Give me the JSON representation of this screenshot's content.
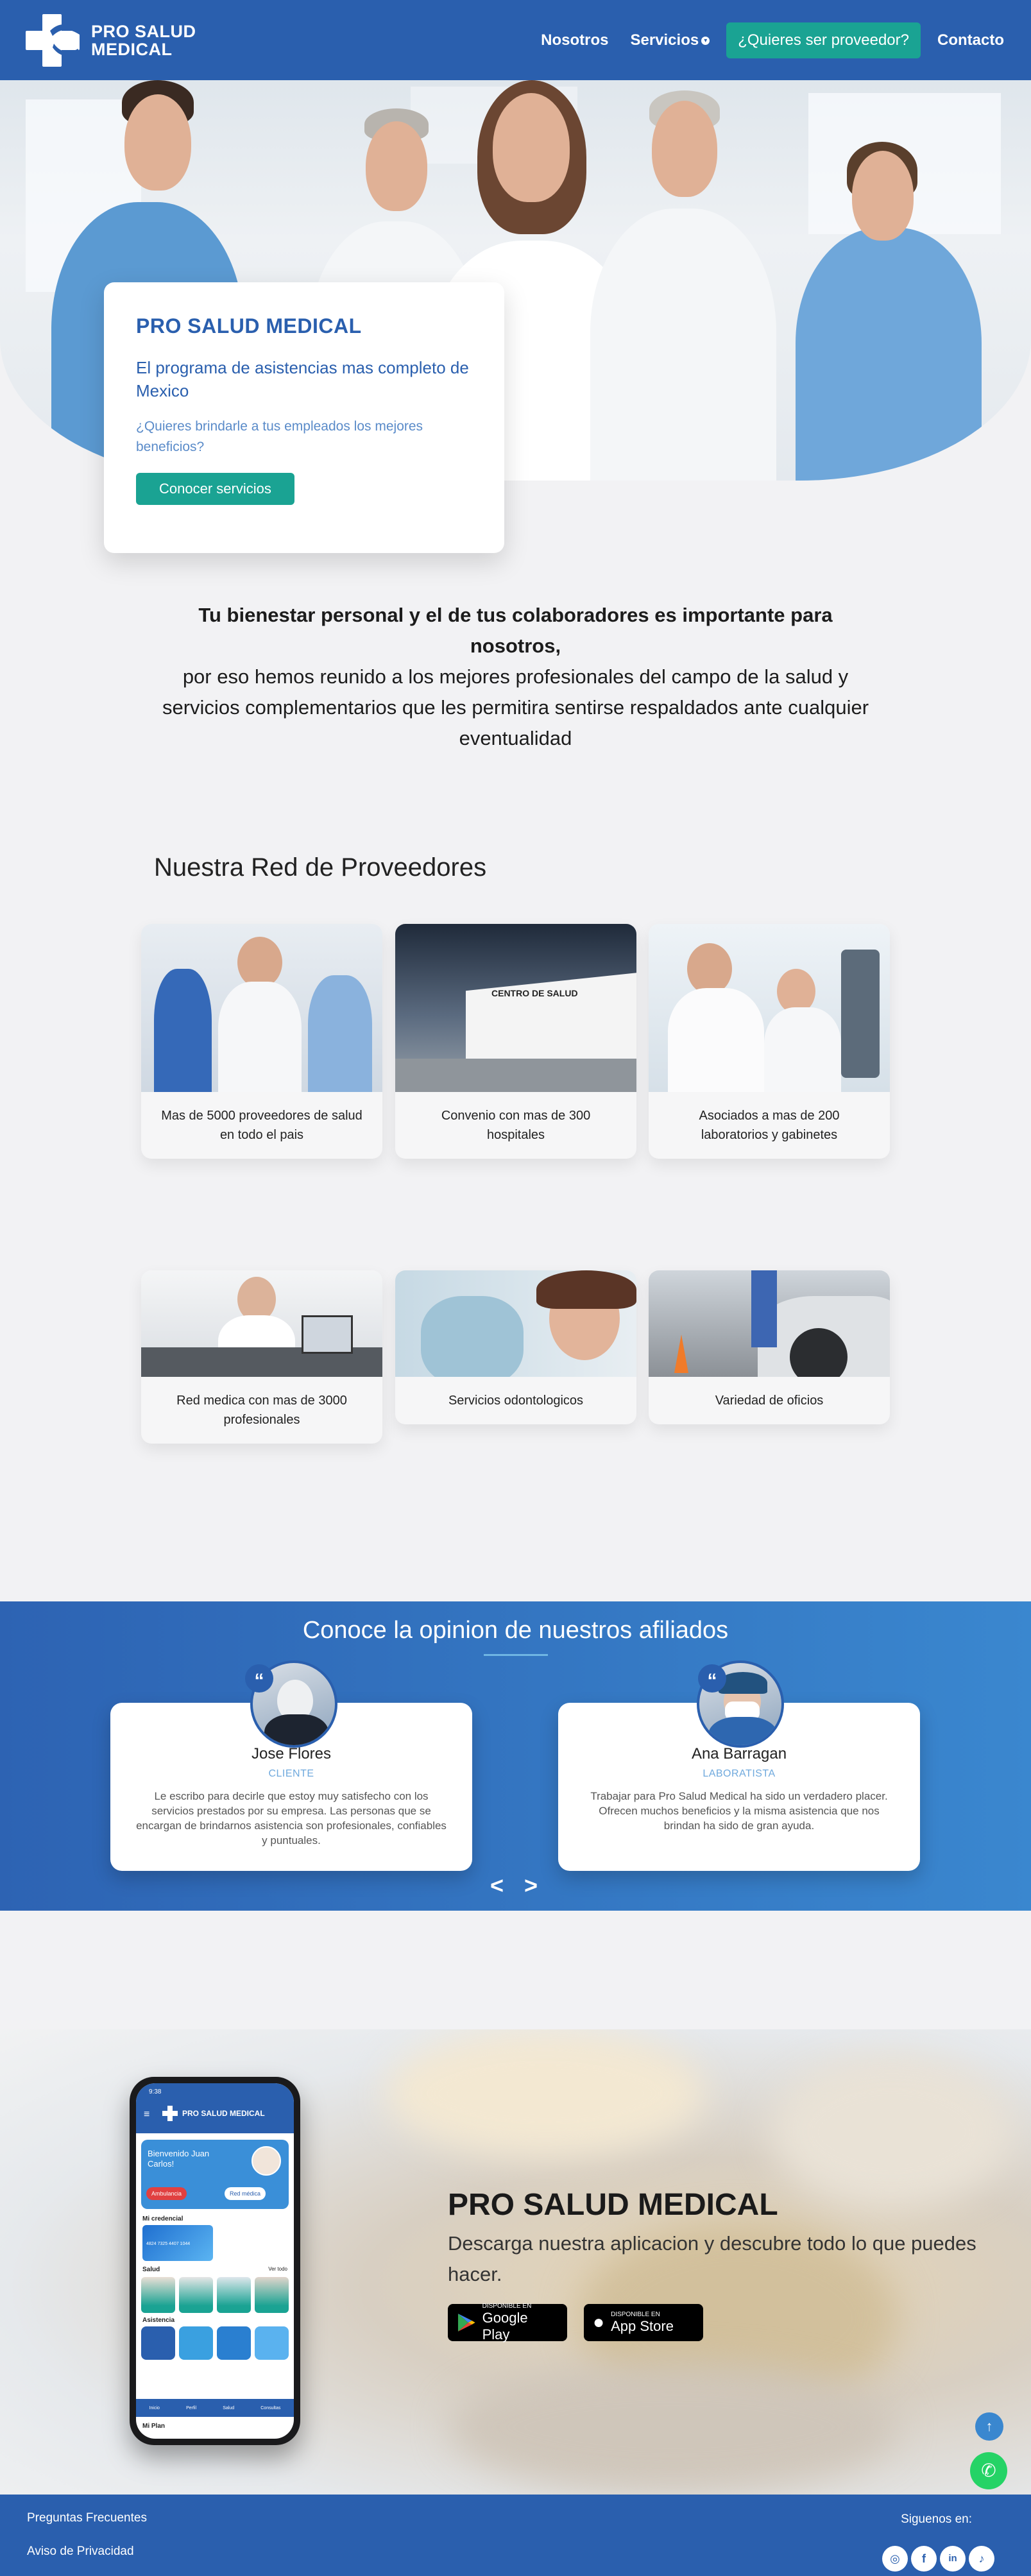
{
  "brand": {
    "line1": "PRO SALUD",
    "line2": "MEDICAL"
  },
  "nav": {
    "items": [
      {
        "label": "Nosotros"
      },
      {
        "label": "Servicios"
      },
      {
        "label": "¿Quieres ser proveedor?"
      },
      {
        "label": "Contacto"
      }
    ]
  },
  "hero": {
    "title": "PRO SALUD MEDICAL",
    "subtitle": "El programa de asistencias mas completo de Mexico",
    "question": "¿Quieres brindarle a tus empleados los mejores beneficios?",
    "button": "Conocer servicios"
  },
  "intro": {
    "bold": "Tu bienestar personal y el de tus colaboradores es importante para nosotros,",
    "rest": "por eso hemos reunido a los mejores profesionales del campo de la salud y servicios complementarios que les permitira sentirse respaldados ante cualquier eventualidad"
  },
  "providers": {
    "title": "Nuestra Red de Proveedores",
    "cards": [
      {
        "caption": "Mas de 5000 proveedores de salud en todo el pais"
      },
      {
        "caption": "Convenio con mas de 300 hospitales"
      },
      {
        "caption": "Asociados a mas de 200 laboratorios y gabinetes"
      },
      {
        "caption": "Red medica con mas de 3000 profesionales"
      },
      {
        "caption": "Servicios odontologicos"
      },
      {
        "caption": "Variedad de oficios"
      }
    ]
  },
  "testimonials": {
    "title": "Conoce la opinion de nuestros afiliados",
    "items": [
      {
        "name": "Jose Flores",
        "role": "CLIENTE",
        "text": "Le escribo para decirle que estoy muy satisfecho con los servicios prestados por su empresa. Las personas que se encargan de brindarnos asistencia son profesionales, confiables y puntuales."
      },
      {
        "name": "Ana Barragan",
        "role": "LABORATISTA",
        "text": "Trabajar para Pro Salud Medical ha sido un verdadero placer. Ofrecen muchos beneficios y la misma asistencia que nos brindan ha sido de gran ayuda."
      }
    ],
    "prev": "<",
    "next": ">"
  },
  "app": {
    "title": "PRO SALUD MEDICAL",
    "subtitle": "Descarga nuestra aplicacion y descubre todo lo que puedes hacer.",
    "google": {
      "small": "DISPONIBLE EN",
      "big": "Google Play"
    },
    "apple": {
      "small": "DISPONIBLE EN",
      "big": "App Store"
    },
    "phone": {
      "time": "9:38",
      "header": "PRO SALUD MEDICAL",
      "greeting": "Bienvenido Juan Carlos!",
      "btn1": "Ambulancia",
      "btn2": "Red médica",
      "credential_label": "Mi credencial",
      "card_number": "4824 7325 4407 1044",
      "health_label": "Salud",
      "see_all": "Ver todo",
      "assist_label": "Asistencia",
      "plan_label": "Mi Plan",
      "tabs": [
        "Inicio",
        "Perfil",
        "Salud",
        "Consultas"
      ]
    }
  },
  "footer": {
    "faq": "Preguntas Frecuentes",
    "privacy": "Aviso de Privacidad",
    "follow": "Siguenos en:"
  },
  "colors": {
    "primary": "#2a5fae",
    "accent": "#1aa393",
    "light_blue": "#6fa9dd"
  }
}
